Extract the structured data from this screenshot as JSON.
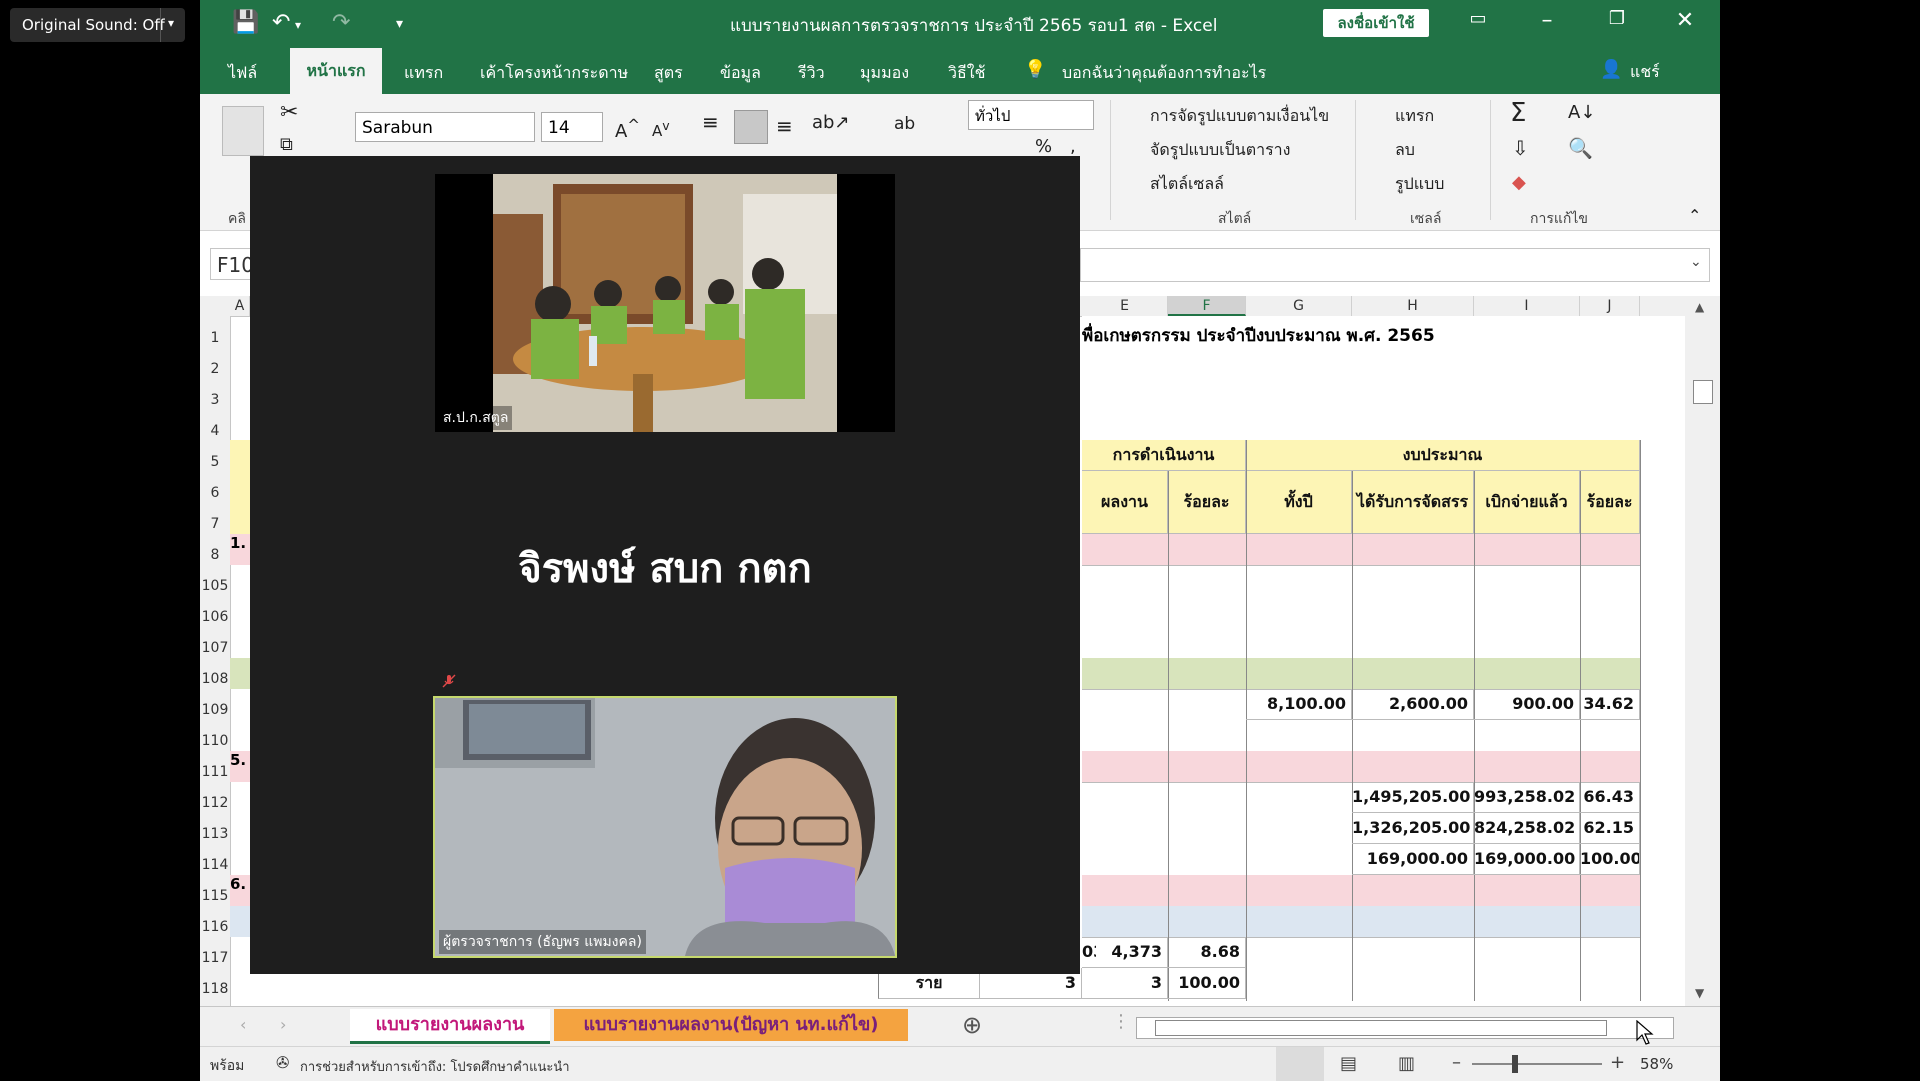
{
  "original_sound": "Original Sound: Off",
  "window": {
    "title": "แบบรายงานผลการตรวจราชการ ประจำปี 2565 รอบ1 สต - Excel",
    "signin": "ลงชื่อเข้าใช้"
  },
  "ribbon_tabs": [
    "ไฟล์",
    "หน้าแรก",
    "แทรก",
    "เค้าโครงหน้ากระดาษ",
    "สูตร",
    "ข้อมูล",
    "รีวิว",
    "มุมมอง",
    "วิธีใช้"
  ],
  "tell_me": "บอกฉันว่าคุณต้องการทำอะไร",
  "share": "แชร์",
  "ribbon": {
    "font_name": "Sarabun",
    "font_size": "14",
    "number_format": "ทั่วไป",
    "cond_format": "การจัดรูปแบบตามเงื่อนไข",
    "format_table": "จัดรูปแบบเป็นตาราง",
    "cell_styles": "สไตล์เซลล์",
    "styles_group": "สไตล์",
    "insert": "แทรก",
    "delete": "ลบ",
    "format": "รูปแบบ",
    "cells_group": "เซลล์",
    "editing_group": "การแก้ไข",
    "clipboard_group": "คลิ"
  },
  "name_box": "F10",
  "columns": [
    "A",
    "E",
    "F",
    "G",
    "H",
    "I",
    "J"
  ],
  "rows": [
    "1",
    "2",
    "3",
    "4",
    "5",
    "6",
    "7",
    "8",
    "105",
    "106",
    "107",
    "108",
    "109",
    "110",
    "111",
    "112",
    "113",
    "114",
    "115",
    "116",
    "117",
    "118"
  ],
  "sheet": {
    "title_fragment": "พื่อเกษตรกรรม ประจำปีงบประมาณ พ.ศ. 2565",
    "hdr_operation": "การดำเนินงาน",
    "hdr_budget": "งบประมาณ",
    "hdr_result": "ผลงาน",
    "hdr_percent": "ร้อยละ",
    "hdr_total": "ทั้งปี",
    "hdr_allocated": "ได้รับการจัดสรร",
    "hdr_spent": "เบิกจ่ายแล้ว",
    "hdr_percent2": "ร้อยละ",
    "row_a_8": "1.",
    "row_a_111": "5.",
    "row_a_115": "6.",
    "r109": [
      "8,100.00",
      "2,600.00",
      "900.00",
      "34.62"
    ],
    "r112": [
      "1,495,205.00",
      "993,258.02",
      "66.43"
    ],
    "r113": [
      "1,326,205.00",
      "824,258.02",
      "62.15"
    ],
    "r114": [
      "169,000.00",
      "169,000.00",
      "100.00"
    ],
    "r117": [
      "03",
      "4,373",
      "8.68"
    ],
    "r118": [
      "ราย",
      "3",
      "3",
      "100.00"
    ]
  },
  "sheet_tabs": [
    "แบบรายงานผลงาน",
    "แบบรายงานผลงาน(ปัญหา นท.แก้ไข)"
  ],
  "status": {
    "ready": "พร้อม",
    "accessibility": "การช่วยสำหรับการเข้าถึง: โปรดศึกษาคำแนะนำ",
    "zoom": "58%"
  },
  "video": {
    "tile1_name": "ส.ป.ก.สตูล",
    "speaker_name": "จิรพงษ์ สบก กตก",
    "tile2_name": "ผู้ตรวจราชการ (ธัญพร แพมงคล)"
  },
  "colors": {
    "excel_green": "#217346",
    "yellow_header": "#fdf5b5",
    "pink_row": "#f8d7dc",
    "green_row": "#d8e4bc",
    "blue_row": "#dce6f1"
  }
}
